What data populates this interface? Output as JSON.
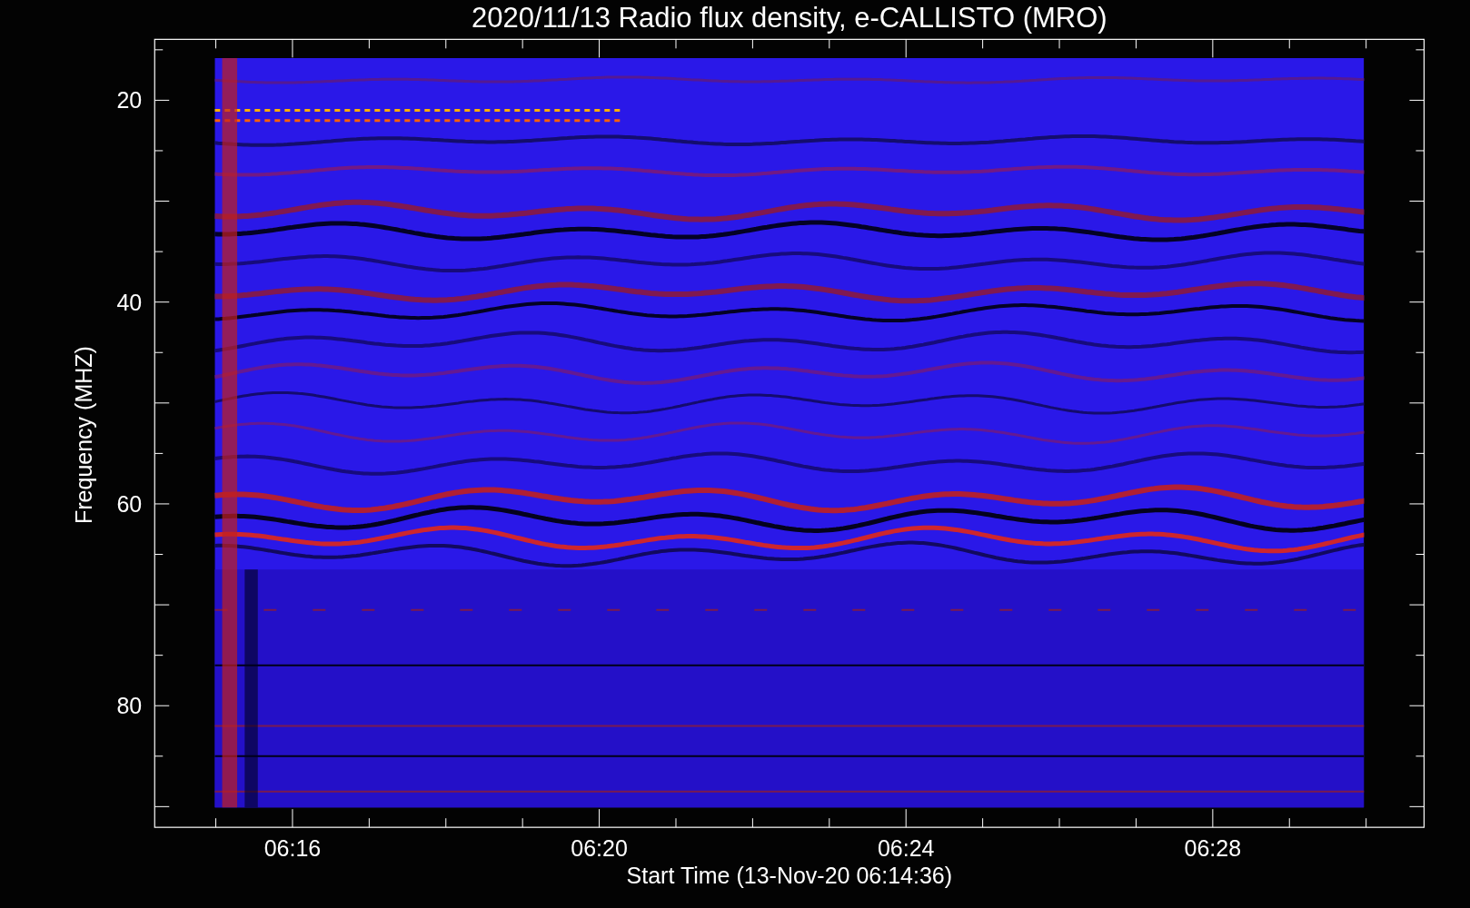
{
  "title": "2020/11/13  Radio flux density, e-CALLISTO (MRO)",
  "plot": {
    "y_axis": {
      "label": "Frequency (MHZ)",
      "tick_labels": [
        "20",
        "40",
        "60",
        "80"
      ]
    },
    "x_axis": {
      "label": "Start Time (13-Nov-20 06:14:36)",
      "tick_labels": [
        "06:16",
        "06:20",
        "06:24",
        "06:28"
      ]
    }
  }
}
